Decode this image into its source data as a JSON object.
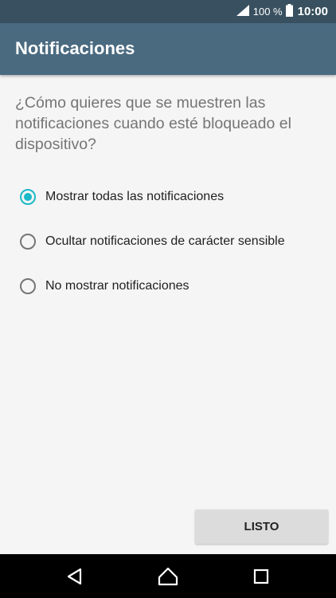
{
  "status_bar": {
    "battery_text": "100 %",
    "time": "10:00"
  },
  "app_bar": {
    "title": "Notificaciones"
  },
  "prompt": "¿Cómo quieres que se muestren las notificaciones cuando esté bloqueado el dispositivo?",
  "options": [
    {
      "label": "Mostrar todas las notificaciones",
      "selected": true
    },
    {
      "label": "Ocultar notificaciones de carácter sensible",
      "selected": false
    },
    {
      "label": "No mostrar notificaciones",
      "selected": false
    }
  ],
  "done_button": {
    "label": "LISTO"
  },
  "nav_bar": {
    "icons": [
      "back-icon",
      "home-icon",
      "recents-icon"
    ]
  },
  "colors": {
    "status_bar": "#38505f",
    "app_bar": "#4a6a80",
    "accent": "#1cb9c8",
    "background": "#f5f5f5",
    "nav_bar": "#000000"
  }
}
